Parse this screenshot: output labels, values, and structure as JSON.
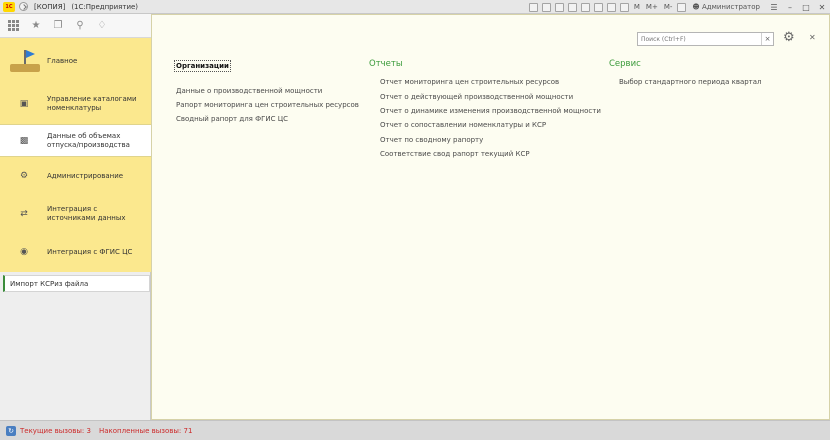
{
  "window": {
    "title_parts": [
      "[КОПИЯ]",
      "(1С:Предприятие)"
    ],
    "app_logo": "1С",
    "user": "Администратор",
    "memory_buttons": [
      "M",
      "M+",
      "M-"
    ]
  },
  "sidebar": {
    "items": [
      {
        "label": "Главное",
        "icon": "main-flag-icon"
      },
      {
        "label": "Управление каталогами номенклатуры",
        "icon": "catalog-icon"
      },
      {
        "label": "Данные об объемах отпуска/производства",
        "icon": "volume-icon"
      },
      {
        "label": "Администрирование",
        "icon": "gear-icon"
      },
      {
        "label": "Интеграция с источниками данных",
        "icon": "integration-icon"
      },
      {
        "label": "Интеграция с ФГИС ЦС",
        "icon": "fgis-icon"
      }
    ],
    "command": "Импорт КСРиз файла"
  },
  "content": {
    "search_placeholder": "Поиск (Ctrl+F)",
    "columns": [
      {
        "title": "Организации",
        "links": [
          "Данные о производственной мощности",
          "Рапорт мониторинга цен строительных ресурсов",
          "Сводный рапорт для ФГИС ЦС"
        ]
      },
      {
        "title": "Отчеты",
        "links": [
          "Отчет мониторинга цен строительных ресурсов",
          "Отчет о действующей производственной мощности",
          "Отчет о динамике изменения производственной мощности",
          "Отчет о сопоставлении номенклатуры и КСР",
          "Отчет по сводному рапорту",
          "Соответствие свод рапорт текущий КСР"
        ]
      },
      {
        "title": "Сервис",
        "links": [
          "Выбор стандартного периода квартал"
        ]
      }
    ]
  },
  "status": {
    "current_calls": "Текущие вызовы: 3",
    "accumulated_calls": "Накопленные вызовы: 71"
  }
}
